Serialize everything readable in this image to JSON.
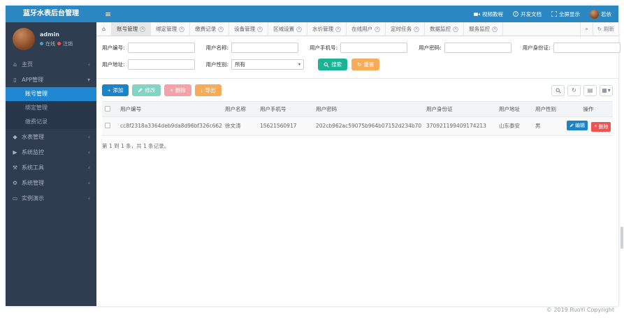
{
  "brand": {
    "title": "蓝牙水表后台管理"
  },
  "header": {
    "video_tutorial": "视频教程",
    "dev_docs": "开发文档",
    "fullscreen": "全屏显示",
    "username": "若依"
  },
  "sidebar": {
    "user": {
      "name": "admin",
      "online": "在线",
      "logout": "注销"
    },
    "home": "主页",
    "app_group": "APP管理",
    "app_children": [
      "账号管理",
      "绑定管理",
      "缴费记录"
    ],
    "active_child": "账号管理",
    "groups": [
      "水表管理",
      "系统监控",
      "系统工具",
      "系统管理",
      "实例演示"
    ]
  },
  "tabs": {
    "items": [
      "账号管理",
      "绑定管理",
      "缴费记录",
      "设备管理",
      "区域设置",
      "水价管理",
      "在线用户",
      "定时任务",
      "数据监控",
      "服务监控"
    ],
    "active": "账号管理",
    "refresh": "刷新"
  },
  "form": {
    "user_no_label": "用户编号:",
    "user_name_label": "用户名称:",
    "user_phone_label": "用户手机号:",
    "user_password_label": "用户密码:",
    "user_idcard_label": "用户身份证:",
    "user_address_label": "用户地址:",
    "user_gender_label": "用户性别:",
    "gender_value": "所有",
    "search": "搜索",
    "reset": "重置"
  },
  "toolbar": {
    "add": "添加",
    "edit": "修改",
    "delete": "删除",
    "export": "导出"
  },
  "table": {
    "headers": [
      "用户编号",
      "用户名称",
      "用户手机号",
      "用户密码",
      "用户身份证",
      "用户地址",
      "用户性别",
      "操作"
    ],
    "row": {
      "user_no": "cc8f2318a3364deb9da8d96bf326c662",
      "name": "徐文涛",
      "phone": "15621560917",
      "password": "202cb962ac59075b964b07152d234b70",
      "id_card": "370921199409174213",
      "address": "山东泰安",
      "gender": "男",
      "edit": "编辑",
      "delete": "删除"
    }
  },
  "pagination": {
    "summary": "第 1 到 1 条，共 1 条记录。"
  },
  "footer": {
    "copyright": "© 2019 RuoYi Copyright"
  },
  "icons": {
    "hamburger": "≡",
    "home": "⌂",
    "chevron_left": "‹",
    "caret_down": "▾",
    "close": "×",
    "plus": "+",
    "export_arrow": "↓",
    "refresh": "↻",
    "angle_double_right": "»",
    "gear": "⚙",
    "droplet": "◆",
    "mobile": "▯",
    "monitor": "▭",
    "video": "▶",
    "wrench": "⚒",
    "list": "▤",
    "grid": "▦"
  },
  "colors": {
    "navbar": "#2b87c1",
    "sidebar": "#2e3e50",
    "active_item": "#1e88d2",
    "success": "#1ab394",
    "info": "#1c84c6",
    "danger": "#ed5565",
    "warning": "#f8ac59"
  }
}
